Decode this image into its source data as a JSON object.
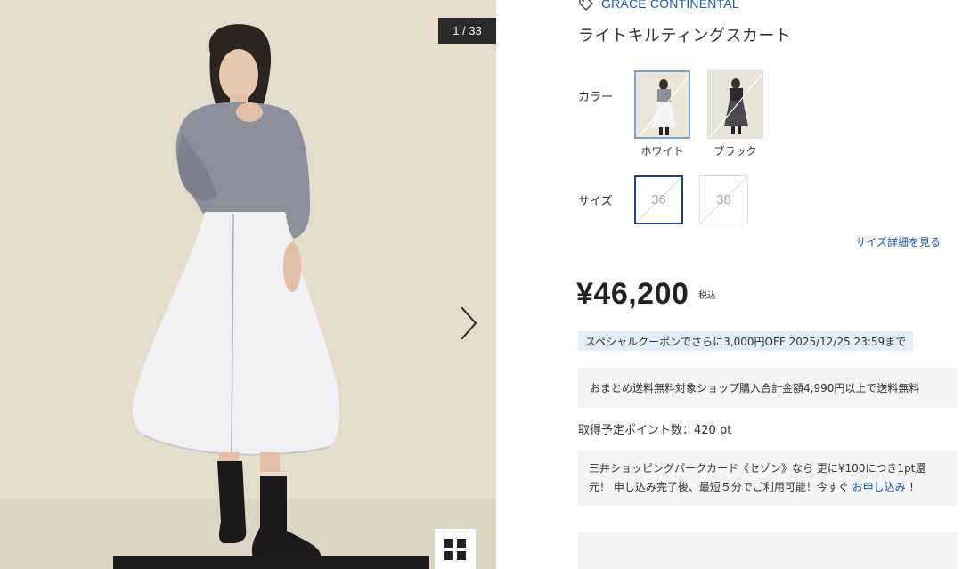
{
  "gallery": {
    "counter": "1 / 33",
    "next_icon": "chevron-right-icon",
    "grid_icon": "grid-view-icon"
  },
  "product": {
    "brand_icon": "tag-icon",
    "brand": "GRACE CONTINENTAL",
    "name": "ライトキルティングスカート"
  },
  "color": {
    "label": "カラー",
    "options": [
      {
        "name": "ホワイト",
        "selected": true
      },
      {
        "name": "ブラック",
        "selected": false
      }
    ]
  },
  "size": {
    "label": "サイズ",
    "options": [
      {
        "name": "36",
        "selected": true
      },
      {
        "name": "38",
        "selected": false
      }
    ],
    "detail_link": "サイズ詳細を見る"
  },
  "price": {
    "amount": "¥46,200",
    "tax_label": "税込"
  },
  "coupon": "スペシャルクーポンでさらに3,000円OFF 2025/12/25 23:59まで",
  "shipping": "おまとめ送料無料対象ショップ購入合計金額4,990円以上で送料無料",
  "points": "取得予定ポイント数：420 pt",
  "card": {
    "text_before": "三井ショッピングパークカード《セゾン》なら 更に¥100につき1pt還元！ 申し込み完了後、最短５分でご利用可能！今すぐ ",
    "link": "お申し込み",
    "text_after": " ！"
  },
  "colors": {
    "link": "#1a56b8",
    "selected_size_border": "#1e3f8a",
    "selected_color_border": "#7ba2da",
    "coupon_bg": "#e2effb",
    "info_box_bg": "#f4f4f4",
    "photo_bg": "#e4ddcc"
  }
}
